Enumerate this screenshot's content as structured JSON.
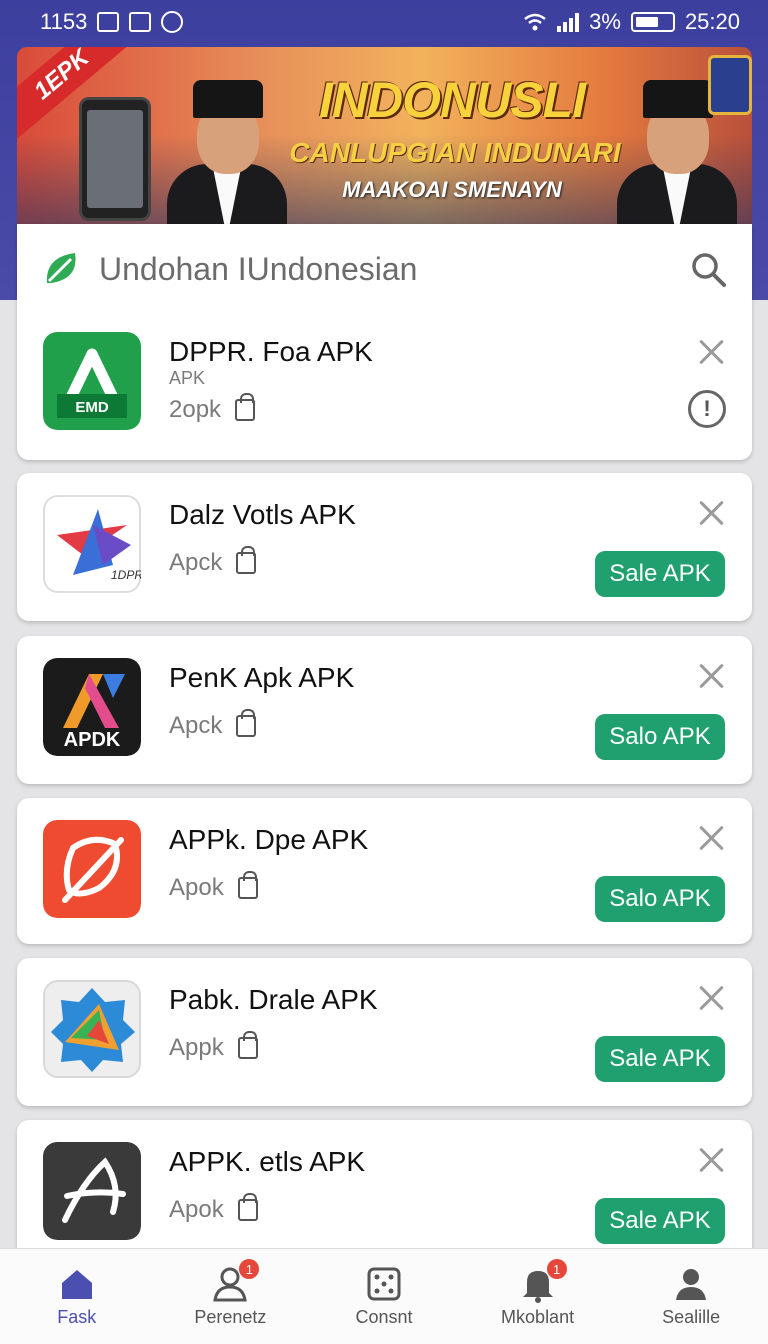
{
  "status_bar": {
    "time_left": "1153",
    "battery_text": "3%",
    "time_right": "25:20"
  },
  "banner": {
    "corner_tag": "1EPK",
    "title": "INDONUSLI",
    "subtitle": "CANLUPGIAN INDUNARI",
    "tagline": "MAAKOAI SMENAYN"
  },
  "search": {
    "placeholder": "Undohan IUndonesian",
    "icon": "search-icon"
  },
  "apps": [
    {
      "name": "DPPR. Foa APK",
      "sub": "APK",
      "meta": "2opk",
      "action": "info",
      "icon_text": "EMD",
      "colors": [
        "#20a04a",
        "#0c7a34"
      ]
    },
    {
      "name": "Dalz Votls APK",
      "meta": "Apck",
      "action": "Sale APK",
      "icon_text": "1DPR",
      "colors": [
        "#ffffff",
        "#e23b46"
      ]
    },
    {
      "name": "PenK Apk APK",
      "meta": "Apck",
      "action": "Salo APK",
      "icon_text": "APDK",
      "colors": [
        "#1b1b1b",
        "#f09a2a"
      ]
    },
    {
      "name": "APPk. Dpe APK",
      "meta": "Apok",
      "action": "Salo APK",
      "icon_text": "",
      "colors": [
        "#ef4b30",
        "#e33a2a"
      ]
    },
    {
      "name": "Pabk. Drale APK",
      "meta": "Appk",
      "action": "Sale APK",
      "icon_text": "",
      "colors": [
        "#eeeeee",
        "#2d8ad6"
      ]
    },
    {
      "name": "APPK. etls APK",
      "meta": "Apok",
      "action": "Sale APK",
      "icon_text": "",
      "colors": [
        "#3a3a3a",
        "#ffffff"
      ]
    }
  ],
  "bottom_nav": [
    {
      "label": "Fask",
      "icon": "home-icon",
      "active": true
    },
    {
      "label": "Perenetz",
      "icon": "people-icon",
      "badge": "1"
    },
    {
      "label": "Consnt",
      "icon": "dice-icon"
    },
    {
      "label": "Mkoblant",
      "icon": "bell-icon",
      "badge": "1"
    },
    {
      "label": "Sealille",
      "icon": "profile-icon"
    }
  ],
  "colors": {
    "header": "#3d3f9e",
    "accent": "#1fa06e",
    "nav_active": "#4b4fb0"
  }
}
